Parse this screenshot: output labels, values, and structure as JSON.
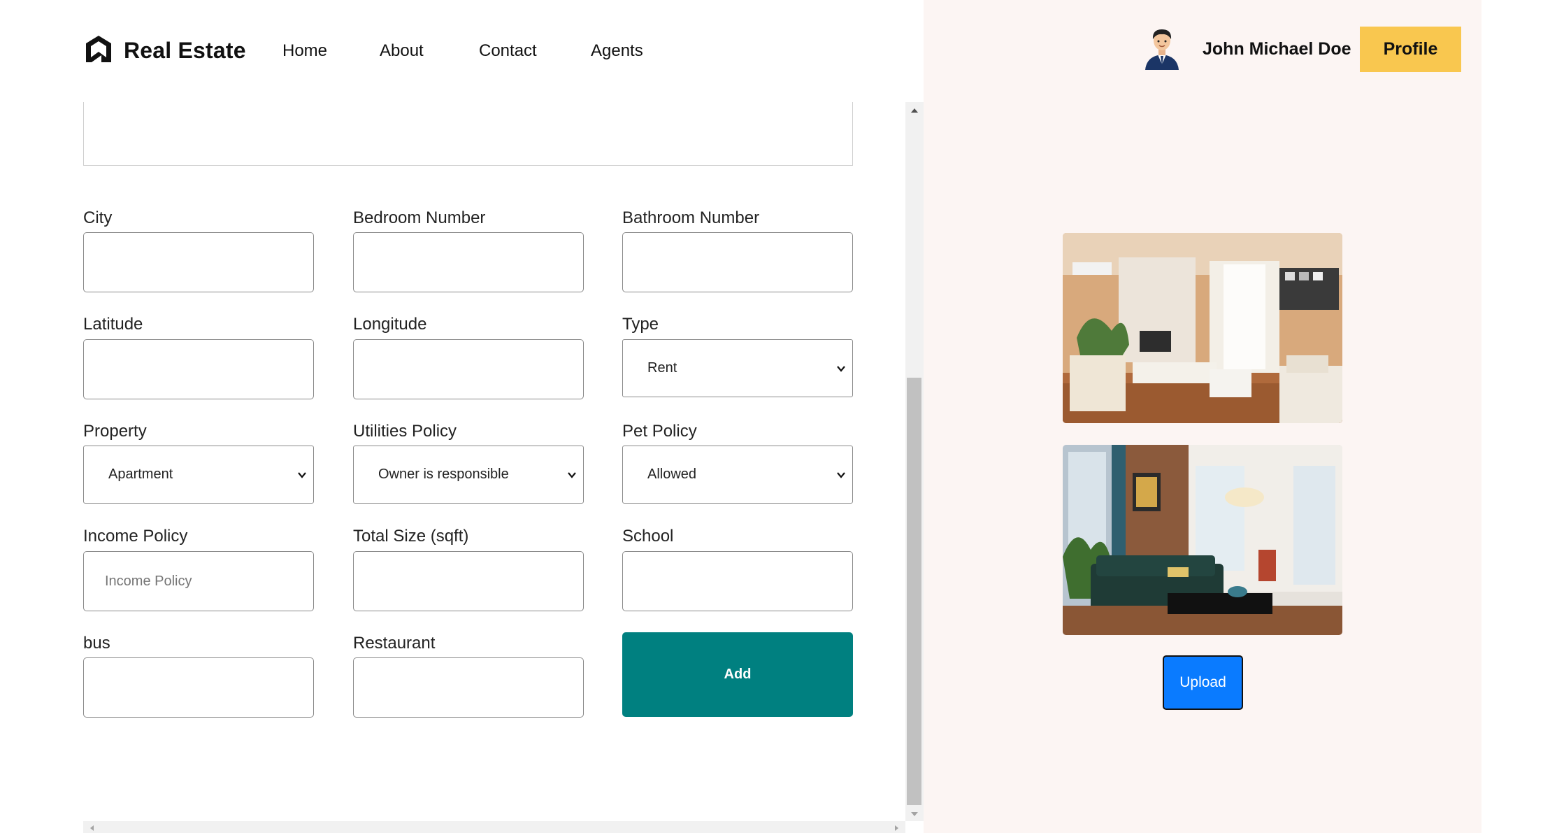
{
  "brand": {
    "name": "Real Estate",
    "logo_icon": "house-logo-icon"
  },
  "nav": {
    "items": [
      "Home",
      "About",
      "Contact",
      "Agents"
    ]
  },
  "user": {
    "name": "John Michael Doe",
    "avatar_icon": "user-avatar-icon",
    "profile_label": "Profile"
  },
  "form": {
    "description_value": "",
    "city": {
      "label": "City",
      "value": ""
    },
    "bedroom": {
      "label": "Bedroom Number",
      "value": ""
    },
    "bathroom": {
      "label": "Bathroom Number",
      "value": ""
    },
    "latitude": {
      "label": "Latitude",
      "value": ""
    },
    "longitude": {
      "label": "Longitude",
      "value": ""
    },
    "type": {
      "label": "Type",
      "value": "Rent"
    },
    "property": {
      "label": "Property",
      "value": "Apartment"
    },
    "utilities": {
      "label": "Utilities Policy",
      "value": "Owner is responsible"
    },
    "pet": {
      "label": "Pet Policy",
      "value": "Allowed"
    },
    "income": {
      "label": "Income Policy",
      "placeholder": "Income Policy",
      "value": ""
    },
    "size": {
      "label": "Total Size (sqft)",
      "value": ""
    },
    "school": {
      "label": "School",
      "value": ""
    },
    "bus": {
      "label": "bus",
      "value": ""
    },
    "restaurant": {
      "label": "Restaurant",
      "value": ""
    },
    "add_label": "Add"
  },
  "gallery": {
    "upload_label": "Upload"
  },
  "colors": {
    "accent_teal": "#008080",
    "profile_yellow": "#f9c74f",
    "upload_blue": "#0a7bff",
    "right_pane_bg": "#fcf5f3"
  }
}
